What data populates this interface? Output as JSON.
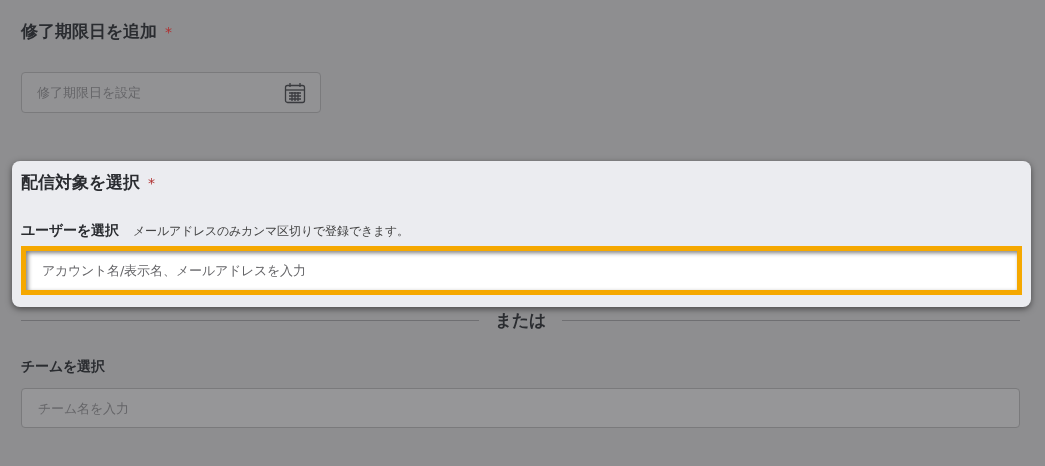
{
  "due_date": {
    "heading": "修了期限日を追加",
    "required_mark": "*",
    "field": {
      "placeholder": "修了期限日を設定"
    }
  },
  "target": {
    "heading": "配信対象を選択",
    "required_mark": "*",
    "highlighted": true,
    "user": {
      "label": "ユーザーを選択",
      "hint": "メールアドレスのみカンマ区切りで登録できます。",
      "placeholder": "アカウント名/表示名、メールアドレスを入力",
      "highlighted": true
    }
  },
  "divider": "または",
  "team": {
    "label": "チームを選択",
    "placeholder": "チーム名を入力"
  }
}
